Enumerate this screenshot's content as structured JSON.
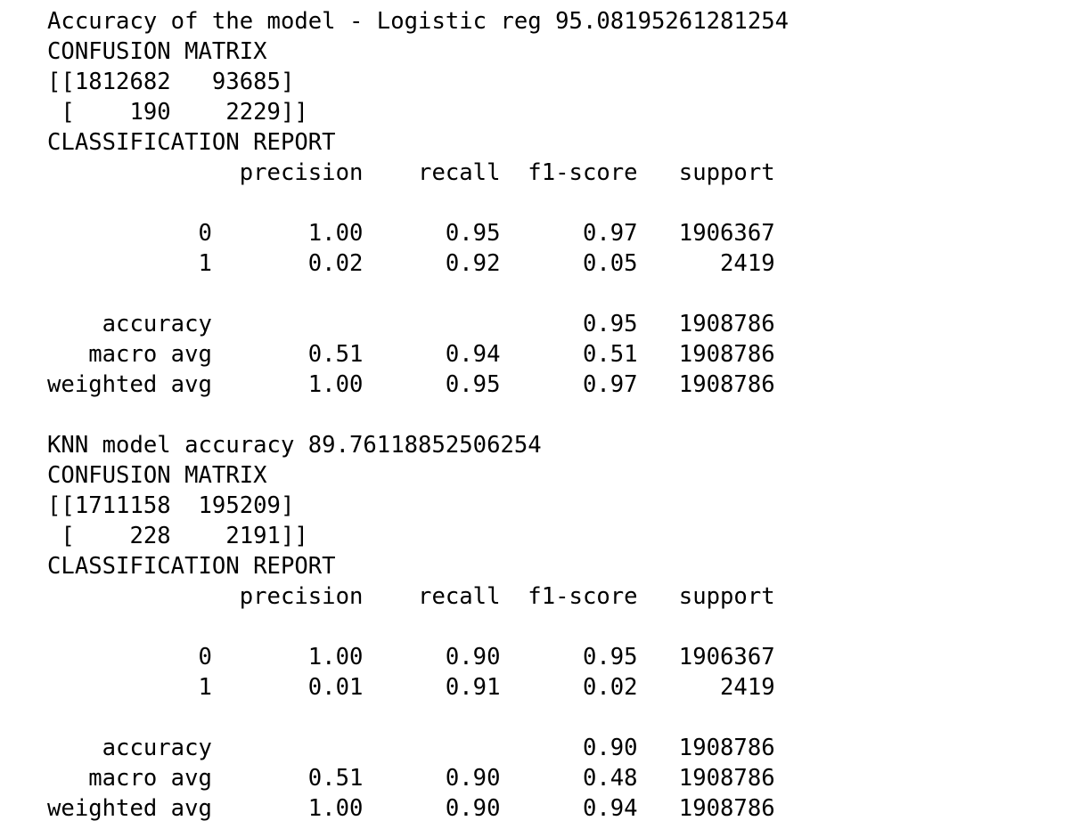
{
  "output_lines": [
    "Accuracy of the model - Logistic reg 95.08195261281254",
    "CONFUSION MATRIX",
    "[[1812682   93685]",
    " [    190    2229]]",
    "CLASSIFICATION REPORT",
    "              precision    recall  f1-score   support",
    "",
    "           0       1.00      0.95      0.97   1906367",
    "           1       0.02      0.92      0.05      2419",
    "",
    "    accuracy                           0.95   1908786",
    "   macro avg       0.51      0.94      0.51   1908786",
    "weighted avg       1.00      0.95      0.97   1908786",
    "",
    "KNN model accuracy 89.76118852506254",
    "CONFUSION MATRIX",
    "[[1711158  195209]",
    " [    228    2191]]",
    "CLASSIFICATION REPORT",
    "              precision    recall  f1-score   support",
    "",
    "           0       1.00      0.90      0.95   1906367",
    "           1       0.01      0.91      0.02      2419",
    "",
    "    accuracy                           0.90   1908786",
    "   macro avg       0.51      0.90      0.48   1908786",
    "weighted avg       1.00      0.90      0.94   1908786"
  ]
}
